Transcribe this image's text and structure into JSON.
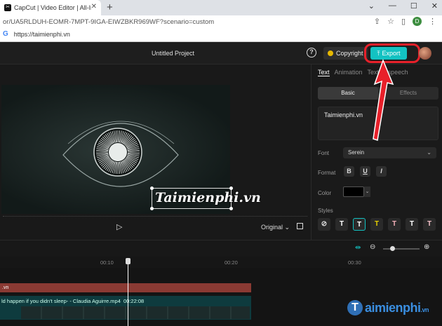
{
  "browser": {
    "tab_title": "CapCut | Video Editor | All-In-One",
    "new_tab": "+",
    "url_full": "or/UA5RLDUH-EOMR-7MPT-9IGA-EIWZBKR969WF?scenario=custom",
    "url_short": "https://taimienphi.vn",
    "profile_initial": "D"
  },
  "header": {
    "project_title": "Untitled Project",
    "help": "?",
    "copyright_label": "Copyright",
    "export_label": "Export"
  },
  "preview": {
    "overlay_text": "Taimienphi.vn",
    "ratio_label": "Original"
  },
  "panel": {
    "tabs": [
      "Text",
      "Animation",
      "Text to speech"
    ],
    "subtabs": [
      "Basic",
      "Effects"
    ],
    "text_value": "Taimienphi.vn",
    "font_label": "Font",
    "font_value": "Serein",
    "format_label": "Format",
    "format_buttons": [
      "B",
      "U",
      "I"
    ],
    "color_label": "Color",
    "color_value": "#000000",
    "styles_label": "Styles",
    "styles": [
      "⊘",
      "T",
      "T",
      "T",
      "T",
      "T",
      "T"
    ]
  },
  "timeline": {
    "ticks": [
      "00:10",
      "00:20",
      "00:30"
    ],
    "text_clip_label": ".vn",
    "video_clip_label": "ld happen if you didn't sleep- - Claudia Aguirre.mp4",
    "video_clip_duration": "00:22:08"
  },
  "watermark": {
    "brand": "aimienphi",
    "suffix": ".vn"
  },
  "colors": {
    "accent": "#13c2c2",
    "annotation": "#e8202a",
    "text_clip": "#8a3a33",
    "video_clip": "#0e3b3e"
  }
}
